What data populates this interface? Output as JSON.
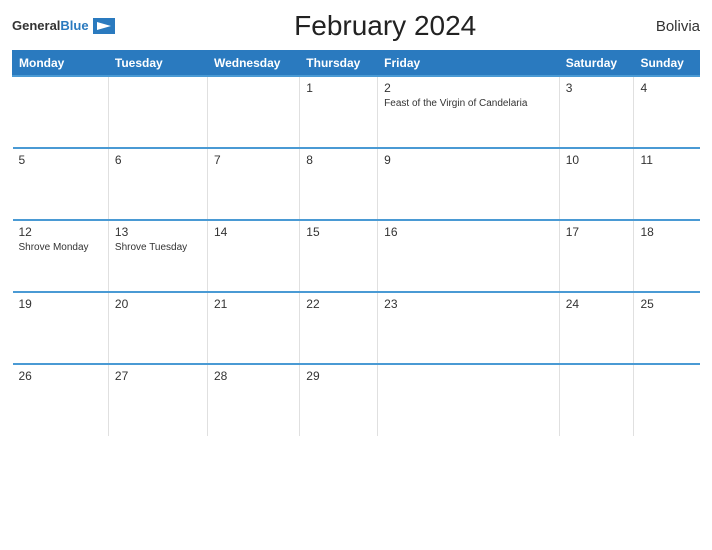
{
  "header": {
    "logo": {
      "general": "General",
      "blue": "Blue"
    },
    "title": "February 2024",
    "country": "Bolivia"
  },
  "weekdays": [
    "Monday",
    "Tuesday",
    "Wednesday",
    "Thursday",
    "Friday",
    "Saturday",
    "Sunday"
  ],
  "weeks": [
    [
      {
        "day": "",
        "holiday": ""
      },
      {
        "day": "",
        "holiday": ""
      },
      {
        "day": "",
        "holiday": ""
      },
      {
        "day": "1",
        "holiday": ""
      },
      {
        "day": "2",
        "holiday": "Feast of the Virgin of Candelaria"
      },
      {
        "day": "3",
        "holiday": ""
      },
      {
        "day": "4",
        "holiday": ""
      }
    ],
    [
      {
        "day": "5",
        "holiday": ""
      },
      {
        "day": "6",
        "holiday": ""
      },
      {
        "day": "7",
        "holiday": ""
      },
      {
        "day": "8",
        "holiday": ""
      },
      {
        "day": "9",
        "holiday": ""
      },
      {
        "day": "10",
        "holiday": ""
      },
      {
        "day": "11",
        "holiday": ""
      }
    ],
    [
      {
        "day": "12",
        "holiday": "Shrove Monday"
      },
      {
        "day": "13",
        "holiday": "Shrove Tuesday"
      },
      {
        "day": "14",
        "holiday": ""
      },
      {
        "day": "15",
        "holiday": ""
      },
      {
        "day": "16",
        "holiday": ""
      },
      {
        "day": "17",
        "holiday": ""
      },
      {
        "day": "18",
        "holiday": ""
      }
    ],
    [
      {
        "day": "19",
        "holiday": ""
      },
      {
        "day": "20",
        "holiday": ""
      },
      {
        "day": "21",
        "holiday": ""
      },
      {
        "day": "22",
        "holiday": ""
      },
      {
        "day": "23",
        "holiday": ""
      },
      {
        "day": "24",
        "holiday": ""
      },
      {
        "day": "25",
        "holiday": ""
      }
    ],
    [
      {
        "day": "26",
        "holiday": ""
      },
      {
        "day": "27",
        "holiday": ""
      },
      {
        "day": "28",
        "holiday": ""
      },
      {
        "day": "29",
        "holiday": ""
      },
      {
        "day": "",
        "holiday": ""
      },
      {
        "day": "",
        "holiday": ""
      },
      {
        "day": "",
        "holiday": ""
      }
    ]
  ]
}
